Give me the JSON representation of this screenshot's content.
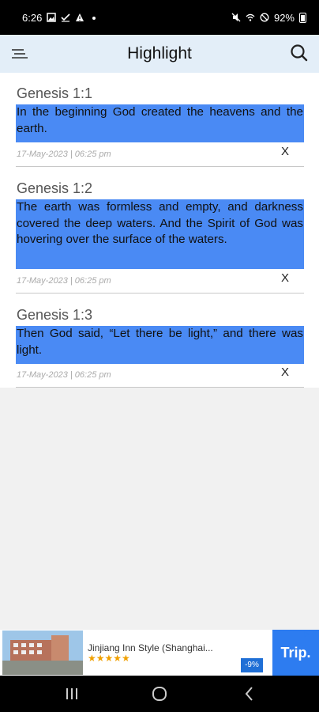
{
  "status_bar": {
    "time": "6:26",
    "battery_text": "92%",
    "icons_left": [
      "image-icon",
      "checkmark-icon",
      "warning-icon",
      "dot-icon"
    ],
    "icons_right": [
      "mute-icon",
      "wifi-icon",
      "do-not-disturb-icon",
      "battery-icon"
    ]
  },
  "app_bar": {
    "title": "Highlight",
    "menu_icon": "menu-icon",
    "search_icon": "search-icon"
  },
  "highlights": [
    {
      "reference": "Genesis 1:1",
      "text": "In the beginning God created the heavens and the earth.",
      "date": "17-May-2023 | 06:25 pm",
      "remove_label": "X"
    },
    {
      "reference": "Genesis 1:2",
      "text": "The earth was formless and empty, and darkness covered the deep waters. And the Spirit of God was hovering over the surface of the waters.",
      "date": "17-May-2023 | 06:25 pm",
      "remove_label": "X"
    },
    {
      "reference": "Genesis 1:3",
      "text": "Then God said, “Let there be light,” and there was light.",
      "date": "17-May-2023 | 06:25 pm",
      "remove_label": "X"
    }
  ],
  "highlight_color": "#4a8af4",
  "ad": {
    "title": "Jinjiang Inn Style (Shanghai...",
    "stars": "★★★★★",
    "discount": "-9%",
    "brand": "Trip."
  },
  "nav_bar": {
    "buttons": [
      "recent-apps-icon",
      "home-icon",
      "back-icon"
    ]
  }
}
